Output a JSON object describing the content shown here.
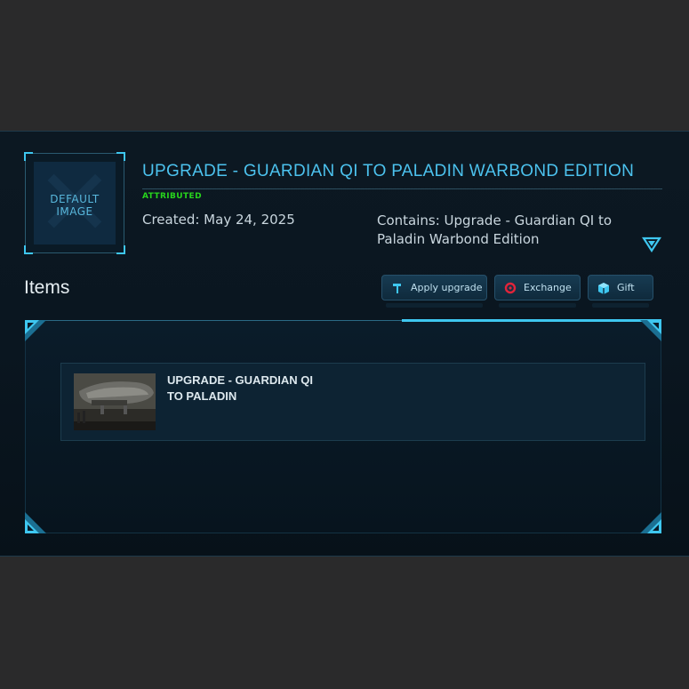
{
  "pledge": {
    "thumbnail_text": "DEFAULT IMAGE",
    "title": "UPGRADE - GUARDIAN QI TO PALADIN WARBOND EDITION",
    "status": "ATTRIBUTED",
    "created": "Created: May 24, 2025",
    "contains": "Contains: Upgrade - Guardian QI to Paladin Warbond Edition"
  },
  "items_section": {
    "heading": "Items",
    "buttons": {
      "apply_upgrade": "Apply upgrade",
      "exchange": "Exchange",
      "gift": "Gift"
    },
    "list": [
      {
        "title": "UPGRADE - GUARDIAN QI TO PALADIN"
      }
    ]
  },
  "colors": {
    "accent": "#4cc2ee",
    "status_green": "#27d41c",
    "background": "#0a1620"
  },
  "icons": [
    "chevron-down-icon",
    "hammer-icon",
    "exchange-icon",
    "gift-icon"
  ]
}
